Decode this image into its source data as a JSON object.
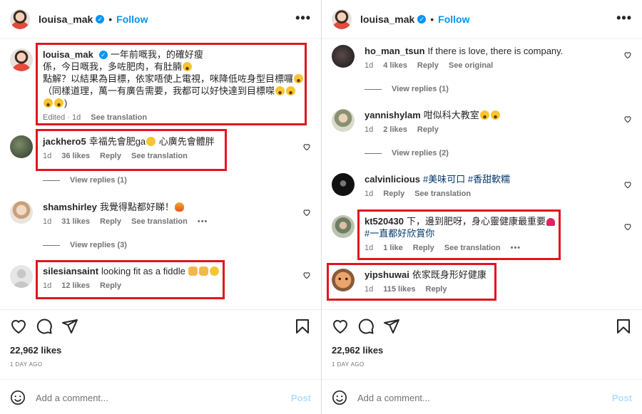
{
  "left": {
    "header": {
      "username": "louisa_mak",
      "separator": "•",
      "follow_label": "Follow"
    },
    "caption": {
      "username": "louisa_mak",
      "text_line1": "一年前嘅我，的確好瘦",
      "text_line2": "係，今日嘅我，多咗肥肉，有肚腩",
      "text_line3": "點解？以結果為目標，依家唔使上電視，咪降低咗身型目標囉",
      "text_line4": "（同樣道理，萬一有廣告需要，我都可以好快達到目標㗎",
      "text_line5": ")",
      "edited": "Edited",
      "time": "1d",
      "see_translation": "See translation"
    },
    "comments": [
      {
        "username": "jackhero5",
        "text": "幸福先會肥ga",
        "text2": "心廣先會體胖",
        "time": "1d",
        "likes": "36 likes",
        "reply": "Reply",
        "see_translation": "See translation"
      },
      {
        "username": "shamshirley",
        "text": "我覺得點都好睇！",
        "time": "1d",
        "likes": "31 likes",
        "reply": "Reply",
        "see_translation": "See translation",
        "more": "•••"
      },
      {
        "username": "silesiansaint",
        "text": "looking fit as a fiddle",
        "time": "1d",
        "likes": "12 likes",
        "reply": "Reply"
      }
    ],
    "view_replies": [
      "View replies (1)",
      "View replies (3)"
    ],
    "likes": "22,962 likes",
    "post_time": "1 DAY AGO",
    "add_comment_placeholder": "Add a comment...",
    "post_label": "Post"
  },
  "right": {
    "header": {
      "username": "louisa_mak",
      "separator": "•",
      "follow_label": "Follow"
    },
    "comments": [
      {
        "username": "ho_man_tsun",
        "text": "If there is love, there is company.",
        "time": "1d",
        "likes": "4 likes",
        "reply": "Reply",
        "see_original": "See original"
      },
      {
        "username": "yannishylam",
        "text": "咁似科大教室",
        "time": "1d",
        "likes": "2 likes",
        "reply": "Reply"
      },
      {
        "username": "calvinlicious",
        "text": "#美味可口 #香甜軟糯",
        "time": "1d",
        "reply": "Reply",
        "see_translation": "See translation"
      },
      {
        "username": "kt520430",
        "text": "下，邊到肥呀，身心靈健康最重要",
        "text2": "#一直都好欣賞你",
        "time": "1d",
        "likes": "1 like",
        "reply": "Reply",
        "see_translation": "See translation",
        "more": "•••"
      },
      {
        "username": "yipshuwai",
        "text": "依家既身形好健康",
        "time": "1d",
        "likes": "115 likes",
        "reply": "Reply"
      }
    ],
    "view_replies": [
      "View replies (1)",
      "View replies (2)"
    ],
    "likes": "22,962 likes",
    "post_time": "1 DAY AGO",
    "add_comment_placeholder": "Add a comment...",
    "post_label": "Post"
  },
  "colors": {
    "highlight": "#e0151d",
    "link_blue": "#0095f6",
    "hashtag": "#00376b",
    "meta_grey": "#737373"
  },
  "icons": [
    "verified-badge-icon",
    "more-options-icon",
    "heart-icon",
    "comment-icon",
    "share-icon",
    "bookmark-icon",
    "emoji-icon"
  ]
}
